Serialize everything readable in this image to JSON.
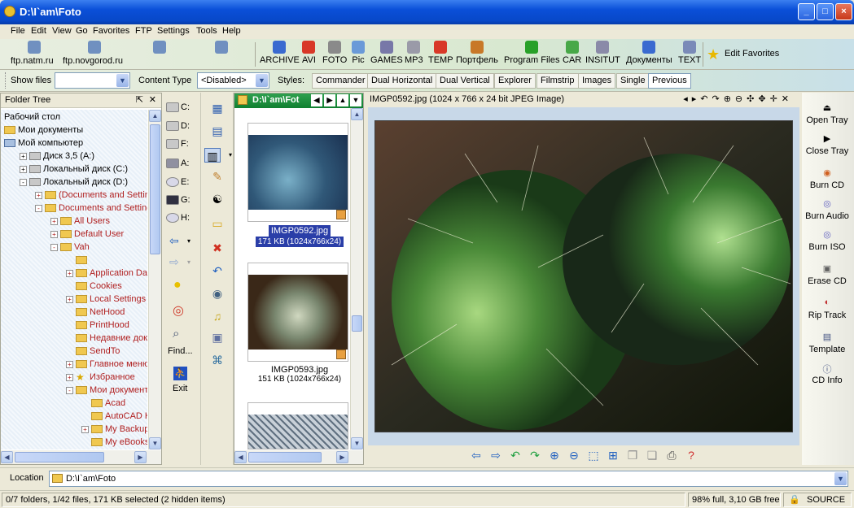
{
  "window": {
    "title": "D:\\I`am\\Foto",
    "min_label": "_",
    "max_label": "□",
    "close_label": "×"
  },
  "menu": [
    "File",
    "Edit",
    "View",
    "Go",
    "Favorites",
    "FTP",
    "Settings",
    "Tools",
    "Help"
  ],
  "ftp_links": [
    "ftp.natm.ru",
    "ftp.novgorod.ru"
  ],
  "favorites": [
    {
      "label": "ARCHIVE",
      "color": "#3a6ad0"
    },
    {
      "label": "AVI",
      "color": "#d83828"
    },
    {
      "label": "FOTO",
      "color": "#8a8a8a"
    },
    {
      "label": "Pic",
      "color": "#6a9ad8"
    },
    {
      "label": "GAMES",
      "color": "#7878a8"
    },
    {
      "label": "MP3",
      "color": "#9a9aa8"
    },
    {
      "label": "TEMP",
      "color": "#d83828"
    },
    {
      "label": "Портфель",
      "color": "#c87828"
    },
    {
      "label": "Program Files",
      "color": "#28a028"
    },
    {
      "label": "CAR",
      "color": "#48a848"
    },
    {
      "label": "INSITUT",
      "color": "#8a8aa8"
    },
    {
      "label": "Документы",
      "color": "#3a6ad0"
    },
    {
      "label": "TEXT",
      "color": "#7a8ab8"
    }
  ],
  "edit_favorites": "Edit Favorites",
  "filters": {
    "show_files_label": "Show files",
    "show_files_value": "",
    "content_type_label": "Content Type",
    "content_type_value": "<Disabled>"
  },
  "styles": {
    "label": "Styles:",
    "buttons": [
      "Commander",
      "Dual Horizontal",
      "Dual Vertical",
      "Explorer",
      "Filmstrip",
      "Images",
      "Single",
      "Previous"
    ],
    "active": "Previous"
  },
  "folder_tree": {
    "title": "Folder Tree",
    "items": [
      {
        "label": "Рабочий стол",
        "level": 0,
        "exp": "",
        "color": "black",
        "icon": "desktop"
      },
      {
        "label": "Мои документы",
        "level": 0,
        "exp": "",
        "color": "black",
        "icon": "folder"
      },
      {
        "label": "Мой компьютер",
        "level": 0,
        "exp": "",
        "color": "black",
        "icon": "computer"
      },
      {
        "label": "Диск 3,5 (A:)",
        "level": 1,
        "exp": "+",
        "color": "black",
        "icon": "drive"
      },
      {
        "label": "Локальный диск (C:)",
        "level": 1,
        "exp": "+",
        "color": "black",
        "icon": "drive"
      },
      {
        "label": "Локальный диск (D:)",
        "level": 1,
        "exp": "-",
        "color": "black",
        "icon": "drive"
      },
      {
        "label": "(Documents and Setting",
        "level": 2,
        "exp": "+",
        "color": "red",
        "icon": "folder"
      },
      {
        "label": "Documents and Settings",
        "level": 2,
        "exp": "-",
        "color": "red",
        "icon": "folder"
      },
      {
        "label": "All Users",
        "level": 3,
        "exp": "+",
        "color": "red",
        "icon": "folder"
      },
      {
        "label": "Default User",
        "level": 3,
        "exp": "+",
        "color": "red",
        "icon": "folder"
      },
      {
        "label": "Vah",
        "level": 3,
        "exp": "-",
        "color": "red",
        "icon": "folder"
      },
      {
        "label": "",
        "level": 4,
        "exp": "",
        "color": "red",
        "icon": "folder"
      },
      {
        "label": "Application Data",
        "level": 4,
        "exp": "+",
        "color": "red",
        "icon": "folder"
      },
      {
        "label": "Cookies",
        "level": 4,
        "exp": "",
        "color": "red",
        "icon": "folder"
      },
      {
        "label": "Local Settings",
        "level": 4,
        "exp": "+",
        "color": "red",
        "icon": "folder"
      },
      {
        "label": "NetHood",
        "level": 4,
        "exp": "",
        "color": "red",
        "icon": "folder"
      },
      {
        "label": "PrintHood",
        "level": 4,
        "exp": "",
        "color": "red",
        "icon": "folder"
      },
      {
        "label": "Недавние доку",
        "level": 4,
        "exp": "",
        "color": "red",
        "icon": "folder"
      },
      {
        "label": "SendTo",
        "level": 4,
        "exp": "",
        "color": "red",
        "icon": "folder"
      },
      {
        "label": "Главное меню",
        "level": 4,
        "exp": "+",
        "color": "red",
        "icon": "folder"
      },
      {
        "label": "Избранное",
        "level": 4,
        "exp": "+",
        "color": "red",
        "icon": "star"
      },
      {
        "label": "Мои документь",
        "level": 4,
        "exp": "-",
        "color": "red",
        "icon": "folder"
      },
      {
        "label": "Acad",
        "level": 5,
        "exp": "",
        "color": "red",
        "icon": "folder"
      },
      {
        "label": "AutoCAD Ha",
        "level": 5,
        "exp": "",
        "color": "red",
        "icon": "folder"
      },
      {
        "label": "My Backups",
        "level": 5,
        "exp": "+",
        "color": "red",
        "icon": "folder"
      },
      {
        "label": "My eBooks",
        "level": 5,
        "exp": "",
        "color": "red",
        "icon": "folder"
      }
    ]
  },
  "drives": [
    "C:",
    "D:",
    "F:",
    "A:",
    "E:",
    "G:",
    "H:"
  ],
  "tool_column": {
    "find_label": "Find...",
    "exit_label": "Exit"
  },
  "thumbs": {
    "path": "D:\\I`am\\Fot",
    "items": [
      {
        "name": "IMGP0592.jpg",
        "size": "171 KB (1024x766x24)",
        "selected": true
      },
      {
        "name": "IMGP0593.jpg",
        "size": "151 KB (1024x766x24)",
        "selected": false
      }
    ]
  },
  "viewer": {
    "title": "IMGP0592.jpg (1024 x 766 x 24 bit JPEG Image)"
  },
  "tray": [
    {
      "label": "Open Tray",
      "icon": "eject-icon"
    },
    {
      "label": "Close Tray",
      "icon": "play-icon"
    },
    {
      "label": "Burn CD",
      "icon": "burn-cd-icon"
    },
    {
      "label": "Burn Audio",
      "icon": "burn-audio-icon"
    },
    {
      "label": "Burn ISO",
      "icon": "burn-iso-icon"
    },
    {
      "label": "Erase CD",
      "icon": "erase-cd-icon"
    },
    {
      "label": "Rip Track",
      "icon": "rip-track-icon"
    },
    {
      "label": "Template",
      "icon": "template-icon"
    },
    {
      "label": "CD Info",
      "icon": "cd-info-icon"
    }
  ],
  "location": {
    "label": "Location",
    "value": "D:\\I`am\\Foto"
  },
  "status": {
    "left": "0/7 folders, 1/42 files, 171 KB selected (2 hidden items)",
    "disk": "98% full, 3,10 GB free",
    "source": "SOURCE"
  }
}
